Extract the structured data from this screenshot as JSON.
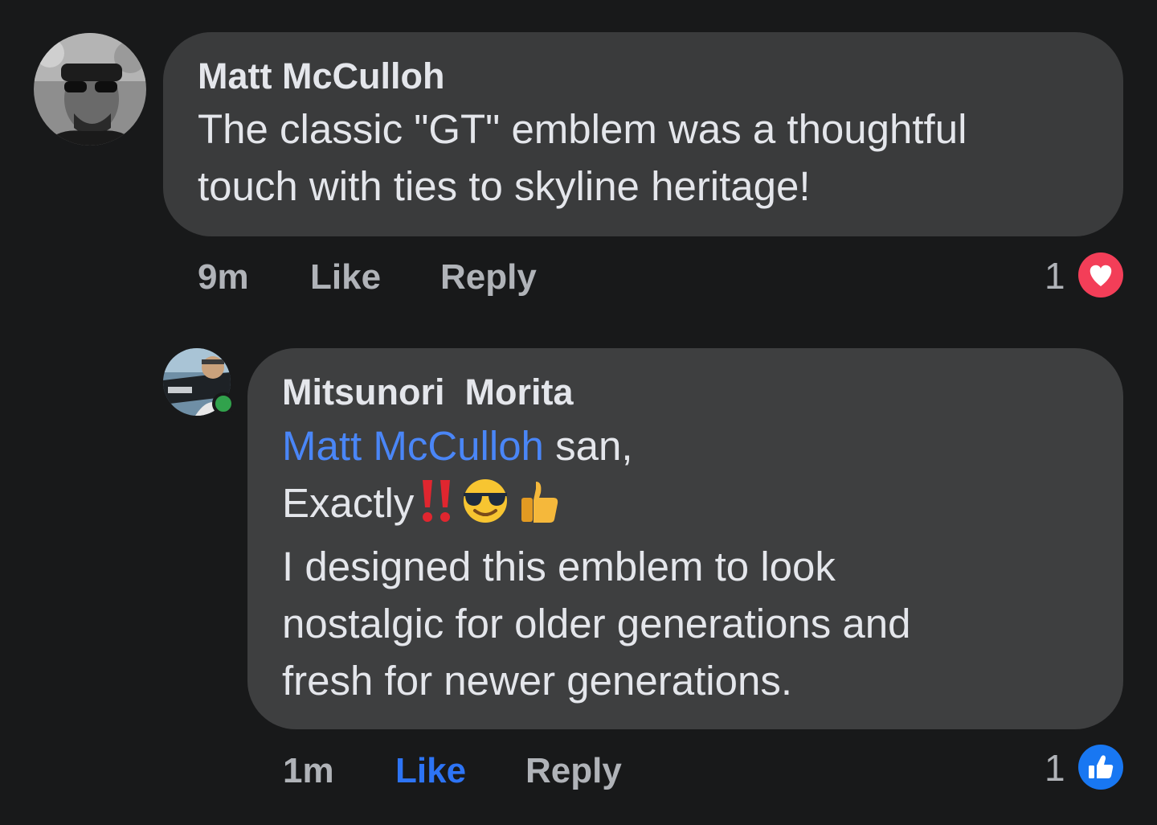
{
  "comments": [
    {
      "author": "Matt McCulloh",
      "text_lines": [
        "The classic \"GT\" emblem was a thoughtful",
        "touch with ties to skyline heritage!"
      ],
      "time": "9m",
      "like_label": "Like",
      "reply_label": "Reply",
      "reaction_count": "1",
      "reaction_icon": "heart-icon",
      "liked": false
    },
    {
      "author": "Mitsunori  Morita",
      "mention": "Matt McCulloh",
      "mention_suffix": " san,",
      "exclaim_line": "Exactly",
      "text_lines": [
        "I designed this emblem to look",
        "nostalgic for older generations and",
        "fresh for newer generations."
      ],
      "time": "1m",
      "like_label": "Like",
      "reply_label": "Reply",
      "reaction_count": "1",
      "reaction_icon": "thumbs-up-icon",
      "liked": true,
      "online": true
    }
  ],
  "colors": {
    "background": "#18191a",
    "bubble": "#3a3b3c",
    "mention": "#4a86f7",
    "like_active": "#2d74f5",
    "heart": "#f33e58",
    "like_badge": "#1877f2",
    "online": "#31a24c"
  }
}
